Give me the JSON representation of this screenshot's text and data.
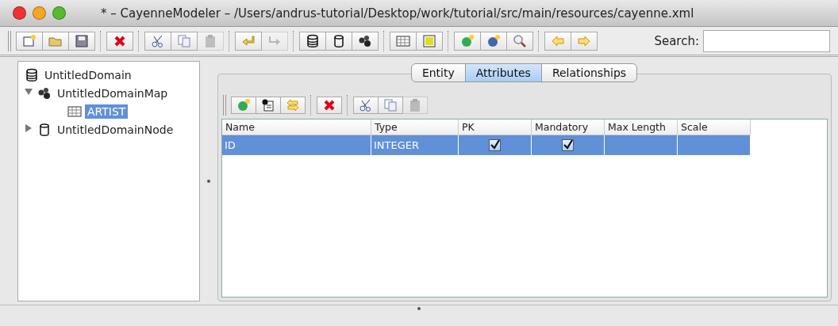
{
  "window": {
    "title": "* – CayenneModeler – /Users/andrus-tutorial/Desktop/work/tutorial/src/main/resources/cayenne.xml"
  },
  "toolbar": {
    "groups": [
      [
        {
          "disabled": false
        },
        {
          "disabled": false
        },
        {
          "disabled": false
        }
      ],
      [
        {
          "disabled": false
        }
      ],
      [
        {
          "disabled": false
        },
        {
          "disabled": false
        },
        {
          "disabled": true
        }
      ],
      [
        {
          "disabled": false
        },
        {
          "disabled": true
        }
      ],
      [
        {
          "disabled": false
        },
        {
          "disabled": false
        },
        {
          "disabled": false
        }
      ],
      [
        {
          "disabled": false
        },
        {
          "disabled": false
        }
      ],
      [
        {
          "disabled": false
        },
        {
          "disabled": false
        },
        {
          "disabled": false
        }
      ],
      [
        {
          "disabled": false
        },
        {
          "disabled": false
        }
      ]
    ],
    "search": {
      "label": "Search:"
    }
  },
  "tree": [
    {
      "label": "UntitledDomain",
      "kind": "domain",
      "selected": false,
      "children": [
        {
          "label": "UntitledDomainMap",
          "kind": "map",
          "expanded": true,
          "selected": false,
          "children": [
            {
              "label": "ARTIST",
              "kind": "entity",
              "selected": true
            }
          ]
        },
        {
          "label": "UntitledDomainNode",
          "kind": "node",
          "expanded": false,
          "selected": false
        }
      ]
    }
  ],
  "tabs": [
    {
      "label": "Entity",
      "selected": false
    },
    {
      "label": "Attributes",
      "selected": true
    },
    {
      "label": "Relationships",
      "selected": false
    }
  ],
  "attr_toolbar": {
    "groups": [
      [
        {
          "disabled": false
        },
        {
          "disabled": false
        },
        {
          "disabled": false
        }
      ],
      [
        {
          "disabled": false
        }
      ],
      [
        {
          "disabled": false
        },
        {
          "disabled": false
        },
        {
          "disabled": true
        }
      ]
    ]
  },
  "table": {
    "columns": [
      "Name",
      "Type",
      "PK",
      "Mandatory",
      "Max Length",
      "Scale"
    ],
    "rows": [
      {
        "name": "ID",
        "type": "INTEGER",
        "pk": true,
        "mandatory": true,
        "selected": true
      }
    ]
  }
}
